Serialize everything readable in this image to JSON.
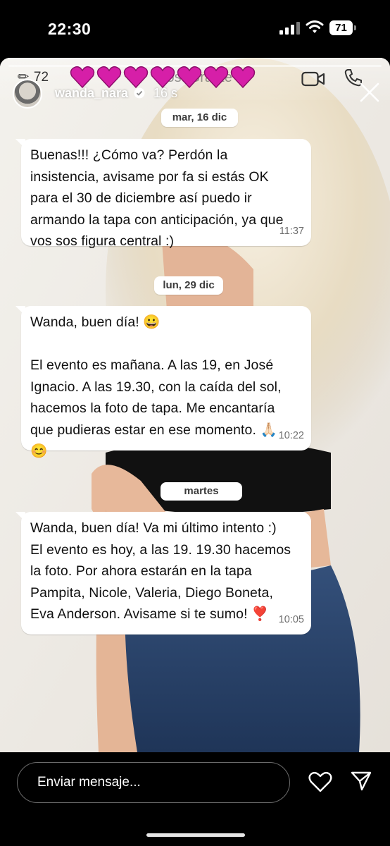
{
  "status_bar": {
    "time": "22:30",
    "battery": "71"
  },
  "story": {
    "views": "72",
    "header_partial": "RosaGrante",
    "username": "wanda_nara",
    "time_ago": "16 s"
  },
  "chat": {
    "messages": [
      {
        "date": "mar, 16 dic",
        "text": "Buenas!!! ¿Cómo va? Perdón la\ninsistencia, avisame por fa si estás OK\npara el 30 de diciembre así puedo ir\narmando la tapa con anticipación, ya que\nvos sos figura central :)",
        "time": "11:37"
      },
      {
        "date": "lun, 29 dic",
        "text": "Wanda, buen día! 😀\n\nEl evento es mañana. A las 19, en José\nIgnacio. A las 19.30, con la caída del sol,\nhacemos la foto de tapa. Me encantaría\nque pudieras estar en ese momento. 🙏🏻\n😊",
        "time": "10:22"
      },
      {
        "date": "martes",
        "text": "Wanda, buen día! Va mi último intento :)\nEl evento es hoy, a las 19. 19.30 hacemos\nla foto. Por ahora estarán en la tapa\nPampita, Nicole, Valeria, Diego Boneta,\nEva Anderson. Avisame si te sumo! ❣️",
        "time": "10:05"
      }
    ]
  },
  "bottom_bar": {
    "placeholder": "Enviar mensaje..."
  },
  "colors": {
    "bubble": "#ffffff",
    "heart_sticker": "#d61fa8",
    "background": "#000000"
  },
  "icons": [
    "signal-icon",
    "wifi-icon",
    "battery-icon",
    "pencil-icon",
    "video-call-icon",
    "phone-icon",
    "verified-icon",
    "close-icon",
    "heart-icon",
    "send-icon"
  ]
}
